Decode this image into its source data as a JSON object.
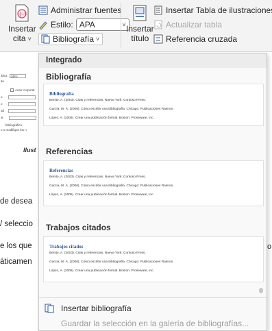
{
  "ribbon": {
    "insert_citation": {
      "line1": "Insertar",
      "line2": "cita"
    },
    "manage_sources": "Administrar fuentes",
    "style_label": "Estilo:",
    "style_value": "APA",
    "bibliography": "Bibliografía",
    "insert_caption": {
      "line1": "Insertar",
      "line2": "título"
    },
    "insert_table_figures": "Insertar Tabla de ilustraciones",
    "update_table": "Actualizar tabla",
    "cross_reference": "Referencia cruzada"
  },
  "background_doc": {
    "mini_labels": [
      "áfica",
      "Libro",
      "ita",
      "Autor corporat",
      "o",
      "o",
      "ad",
      "al",
      "bibliográfico",
      "o o modifique los n"
    ],
    "italic_caption": "Ilust",
    "lines": [
      "de desea",
      "/ seleccio",
      "e los que",
      "áticamen"
    ],
    "right_fragment": "o"
  },
  "gallery": {
    "section_header": "Integrado",
    "items": [
      {
        "label": "Bibliografía",
        "preview_title": "Bibliografía",
        "entries": [
          "Benito, A. (2003). Citas y referencias. Nueva York: Contoso Press.",
          "García, M. Á. (2006). Cómo escribir una bibliografía. Chicago: Publicaciones Raimon.",
          "López, A. (2005). Crear una publicación formal. Boston: Proseware, Inc."
        ]
      },
      {
        "label": "Referencias",
        "preview_title": "Referencias",
        "entries": [
          "Benito, A. (2003). Citas y referencias. Nueva York: Contoso Press.",
          "García, M. Á. (2006). Cómo escribir una bibliografía. Chicago: Publicaciones Raimon.",
          "López, A. (2005). Crear una publicación formal. Boston: Proseware, Inc."
        ]
      },
      {
        "label": "Trabajos citados",
        "preview_title": "Trabajos citados",
        "entries": [
          "Benito, A. (2003). Citas y referencias. Nueva York: Contoso Press.",
          "García, M. Á. (2006). Cómo escribir una bibliografía. Chicago: Publicaciones Raimon.",
          "López, A. (2005). Crear una publicación formal. Boston: Proseware, Inc."
        ]
      }
    ],
    "insert_bibliography": "Insertar bibliografía",
    "save_selection": "Guardar la selección en la galería de bibliografías..."
  },
  "colors": {
    "accent_blue": "#2b579a",
    "preview_title": "#2e5a9c",
    "ribbon_bg": "#f3f3f3"
  },
  "icons": [
    "insert-citation-icon",
    "manage-sources-icon",
    "style-icon",
    "bibliography-icon",
    "insert-caption-icon",
    "table-figures-icon",
    "update-table-icon",
    "cross-reference-icon",
    "insert-bibliography-icon"
  ]
}
